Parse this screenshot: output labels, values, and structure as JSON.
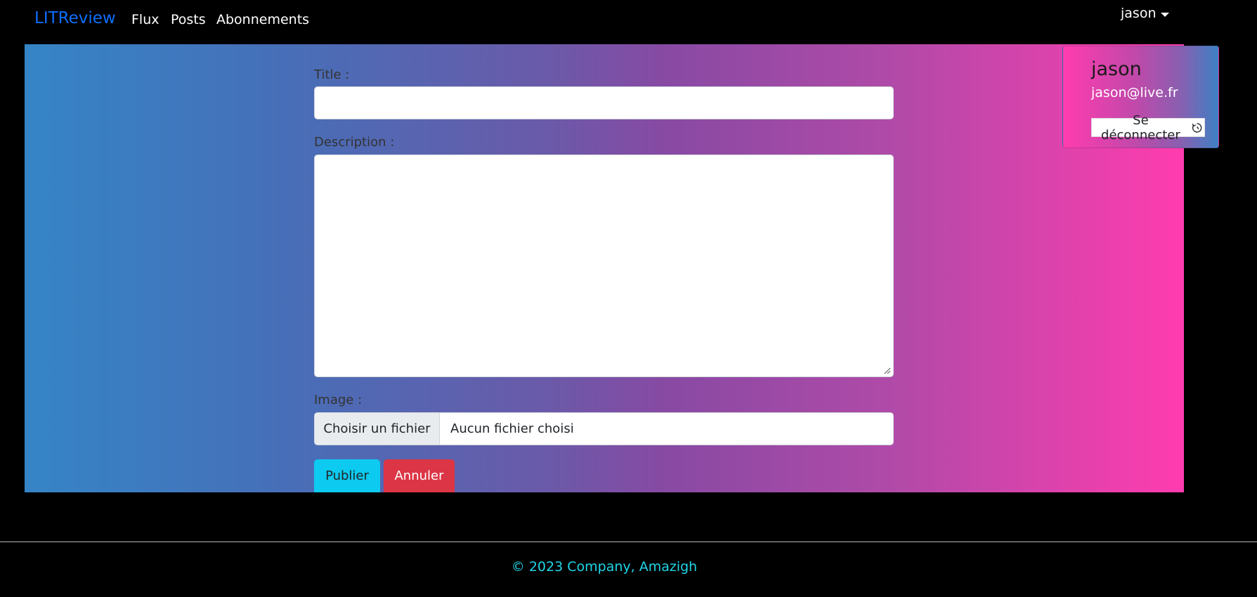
{
  "navbar": {
    "brand": "LITReview",
    "links": [
      "Flux",
      "Posts",
      "Abonnements"
    ],
    "user": "jason"
  },
  "form": {
    "title_label": "Title :",
    "title_value": "",
    "description_label": "Description :",
    "description_value": "",
    "image_label": "Image :",
    "file_button": "Choisir un fichier",
    "file_status": "Aucun fichier choisi",
    "publish_label": "Publier",
    "cancel_label": "Annuler"
  },
  "dropdown": {
    "name": "jason",
    "email": "jason@live.fr",
    "logout_label": "Se déconnecter",
    "logout_icon": "logout-icon"
  },
  "footer": {
    "text": "© 2023 Company, Amazigh"
  },
  "colors": {
    "brand": "#0d6efd",
    "publish": "#0dcaf0",
    "cancel": "#dc3545",
    "footer_text": "#1fd6e8"
  }
}
